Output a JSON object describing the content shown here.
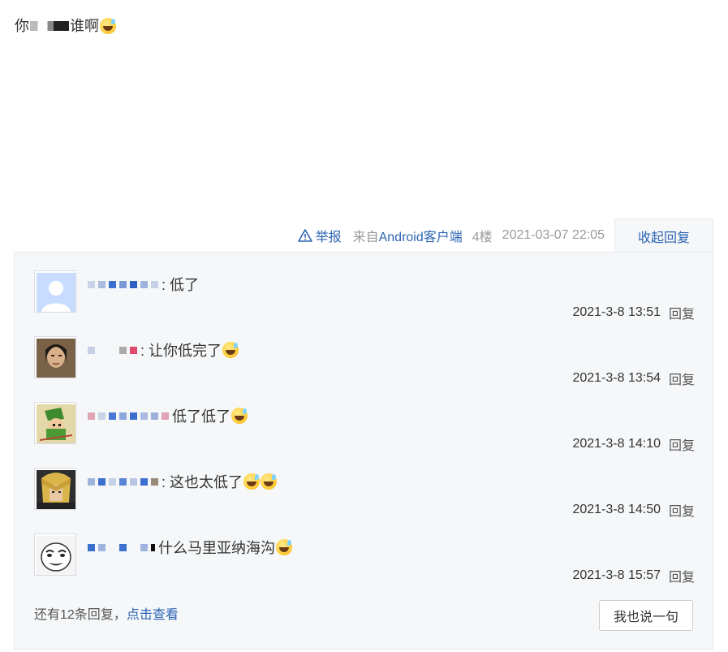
{
  "post": {
    "text_start": "你",
    "text_end": "谁啊",
    "emoji": "grinning-sweat-emoji"
  },
  "meta": {
    "report_label": "举报",
    "from_prefix": "来自",
    "from_client": "Android客户端",
    "floor": "4楼",
    "time": "2021-03-07 22:05",
    "collapse_label": "收起回复"
  },
  "replies": [
    {
      "text": ": 低了",
      "emojis": 0,
      "time": "2021-3-8 13:51",
      "reply_label": "回复",
      "avatar": "default-avatar"
    },
    {
      "text": ": 让你低完了",
      "emojis": 1,
      "time": "2021-3-8 13:54",
      "reply_label": "回复",
      "avatar": "man-avatar"
    },
    {
      "text": " 低了低了",
      "emojis": 1,
      "time": "2021-3-8 14:10",
      "reply_label": "回复",
      "avatar": "link-avatar"
    },
    {
      "text": ": 这也太低了",
      "emojis": 2,
      "time": "2021-3-8 14:50",
      "reply_label": "回复",
      "avatar": "anime-avatar"
    },
    {
      "text": "什么马里亚纳海沟",
      "emojis": 1,
      "time": "2021-3-8 15:57",
      "reply_label": "回复",
      "avatar": "meme-face-avatar"
    }
  ],
  "more": {
    "prefix": "还有12条回复，",
    "link": "点击查看"
  },
  "say_button": "我也说一句",
  "colors": {
    "link": "#2d64b3",
    "panel_bg": "#f5f7f9",
    "border": "#e6e9ee"
  }
}
